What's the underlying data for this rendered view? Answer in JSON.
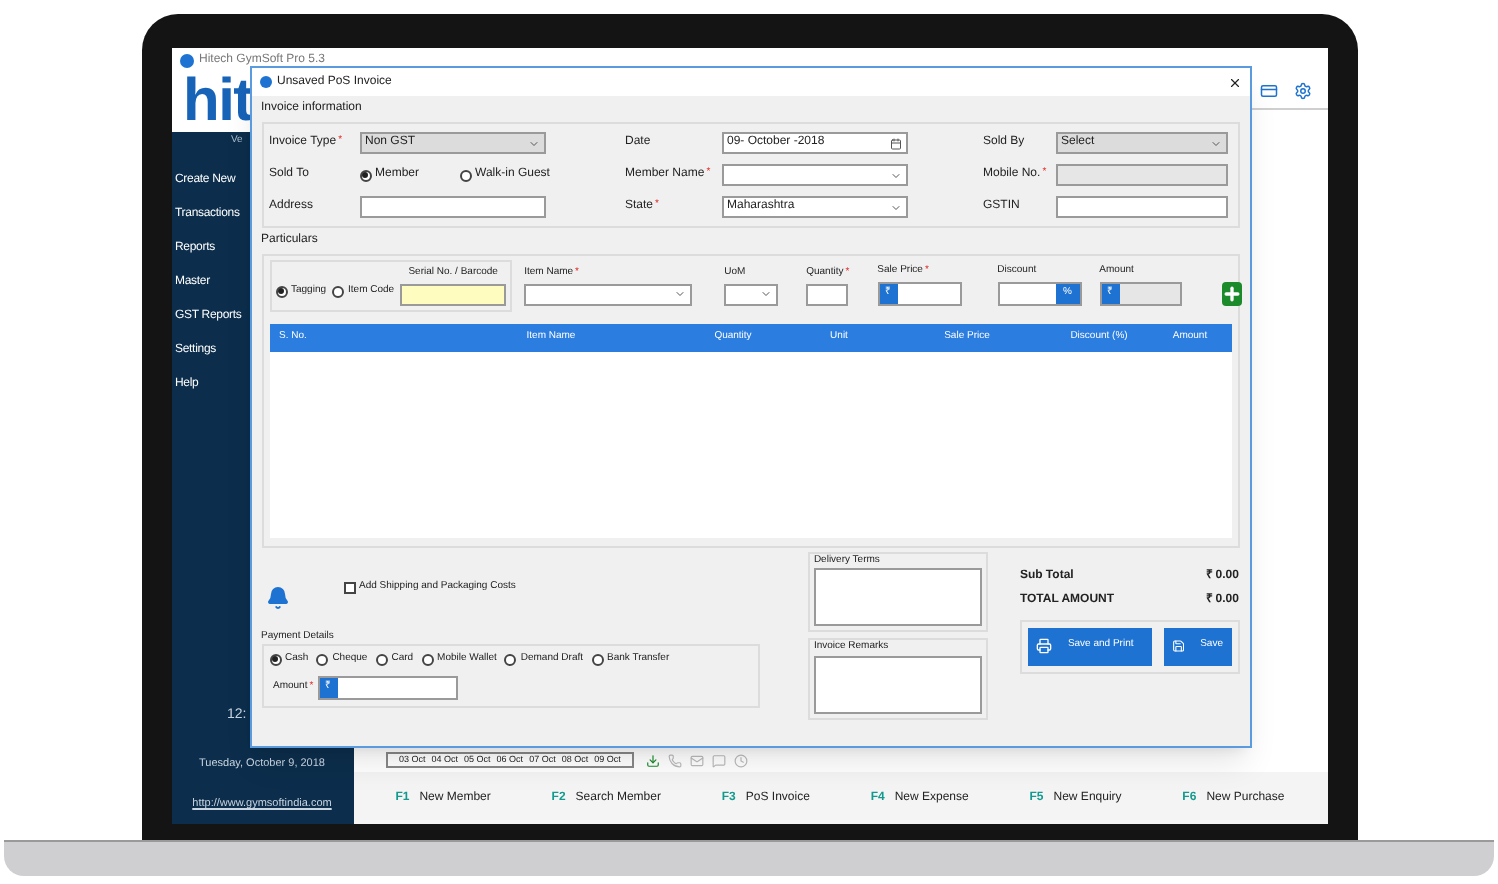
{
  "app": {
    "title": "Hitech GymSoft Pro 5.3",
    "logo": "hit",
    "version": "Ve",
    "time": "12:",
    "date": "Tuesday, October 9, 2018",
    "website": "http://www.gymsoftindia.com"
  },
  "sidebar": {
    "items": [
      {
        "label": "Create New"
      },
      {
        "label": "Transactions"
      },
      {
        "label": "Reports"
      },
      {
        "label": "Master"
      },
      {
        "label": "GST Reports"
      },
      {
        "label": "Settings"
      },
      {
        "label": "Help"
      }
    ]
  },
  "date_strip": [
    "03 Oct",
    "04 Oct",
    "05 Oct",
    "06 Oct",
    "07 Oct",
    "08 Oct",
    "09 Oct"
  ],
  "shortcuts": [
    {
      "key": "F1",
      "label": "New Member"
    },
    {
      "key": "F2",
      "label": "Search Member"
    },
    {
      "key": "F3",
      "label": "PoS Invoice"
    },
    {
      "key": "F4",
      "label": "New Expense"
    },
    {
      "key": "F5",
      "label": "New Enquiry"
    },
    {
      "key": "F6",
      "label": "New Purchase"
    }
  ],
  "dialog": {
    "title": "Unsaved PoS Invoice",
    "invoice_info": {
      "legend": "Invoice information",
      "invoice_type": {
        "label": "Invoice Type",
        "required_mark": "*",
        "value": "Non GST"
      },
      "date": {
        "label": "Date",
        "value": "09-  October  -2018"
      },
      "sold_by": {
        "label": "Sold By",
        "value": "Select"
      },
      "sold_to": {
        "label": "Sold To",
        "options": [
          {
            "label": "Member",
            "selected": true
          },
          {
            "label": "Walk-in Guest",
            "selected": false
          }
        ]
      },
      "member_name": {
        "label": "Member Name",
        "required_mark": "*"
      },
      "mobile": {
        "label": "Mobile No.",
        "required_mark": "*"
      },
      "address": {
        "label": "Address"
      },
      "state": {
        "label": "State",
        "required_mark": "*",
        "value": "Maharashtra"
      },
      "gstin": {
        "label": "GSTIN"
      }
    },
    "particulars": {
      "legend": "Particulars",
      "modes": [
        {
          "label": "Tagging",
          "selected": true
        },
        {
          "label": "Item Code",
          "selected": false
        }
      ],
      "serial": {
        "label": "Serial No. / Barcode"
      },
      "item_name": {
        "label": "Item Name",
        "required_mark": "*"
      },
      "uom": {
        "label": "UoM"
      },
      "quantity": {
        "label": "Quantity",
        "required_mark": "*"
      },
      "sale_price": {
        "label": "Sale Price",
        "required_mark": "*",
        "prefix": "₹"
      },
      "discount": {
        "label": "Discount",
        "suffix": "%"
      },
      "amount": {
        "label": "Amount",
        "prefix": "₹"
      },
      "columns": [
        "S. No.",
        "Item Name",
        "Quantity",
        "Unit",
        "Sale Price",
        "Discount (%)",
        "Amount"
      ]
    },
    "shipping": {
      "label": "Add Shipping and Packaging Costs",
      "checked": false
    },
    "payment": {
      "legend": "Payment Details",
      "options": [
        {
          "label": "Cash",
          "selected": true
        },
        {
          "label": "Cheque",
          "selected": false
        },
        {
          "label": "Card",
          "selected": false
        },
        {
          "label": "Mobile Wallet",
          "selected": false
        },
        {
          "label": "Demand Draft",
          "selected": false
        },
        {
          "label": "Bank Transfer",
          "selected": false
        }
      ],
      "amount": {
        "label": "Amount",
        "required_mark": "*",
        "prefix": "₹"
      }
    },
    "delivery_terms": {
      "label": "Delivery Terms"
    },
    "invoice_remarks": {
      "label": "Invoice Remarks"
    },
    "totals": [
      {
        "label": "Sub Total",
        "value": "₹ 0.00"
      },
      {
        "label": "TOTAL AMOUNT",
        "value": "₹ 0.00"
      }
    ],
    "buttons": [
      {
        "kind": "print",
        "label": "Save and Print"
      },
      {
        "kind": "save",
        "label": "Save"
      }
    ]
  }
}
